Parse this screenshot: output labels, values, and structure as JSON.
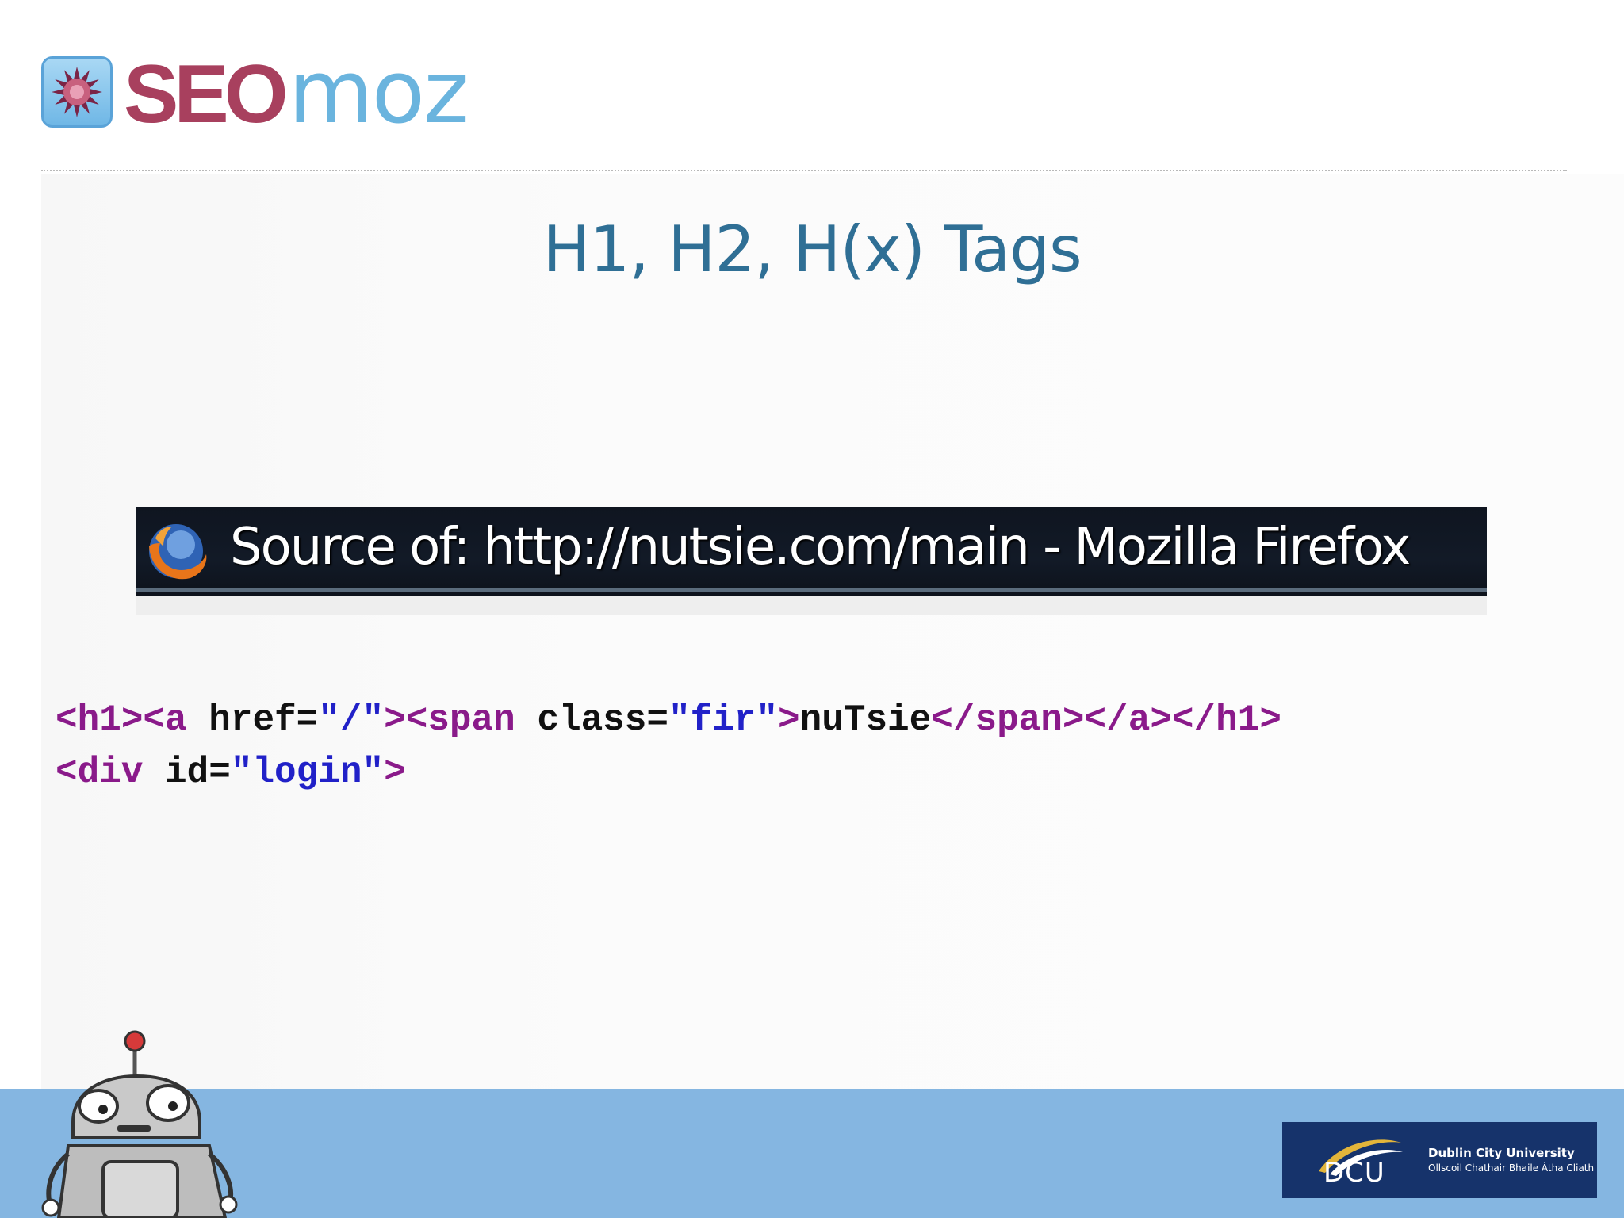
{
  "logo": {
    "part1": "SEO",
    "part2": "moz",
    "icon": "star-badge-icon"
  },
  "slide": {
    "title": "H1, H2, H(x) Tags"
  },
  "browser_bar": {
    "title": "Source of: http://nutsie.com/main - Mozilla Firefox",
    "icon": "firefox-icon"
  },
  "code": {
    "line1": {
      "open_h1": "<h1>",
      "open_a": "<a",
      "href_attr": " href=",
      "href_val": "\"/\"",
      "close_a_bracket": ">",
      "open_span": "<span",
      "class_attr": " class=",
      "class_val": "\"fir\"",
      "close_span_bracket": ">",
      "text": "nuTsie",
      "end_span": "</span>",
      "end_a": "</a>",
      "end_h1": "</h1>"
    },
    "line2": {
      "open_div": "<div",
      "id_attr": " id=",
      "id_val": "\"login\"",
      "close_bracket": ">"
    }
  },
  "footer": {
    "mascot": "robot-mascot-icon",
    "dcu": {
      "mark": "DCU",
      "name": "Dublin City University",
      "irish": "Ollscoil Chathair Bhaile Átha Cliath"
    }
  },
  "colors": {
    "seo": "#a8405e",
    "moz": "#6ab4de",
    "title": "#2f6f95",
    "footer": "#85b6e1",
    "dcu_navy": "#16336b",
    "code_tag": "#8a1a8a",
    "code_value": "#2121c8"
  }
}
